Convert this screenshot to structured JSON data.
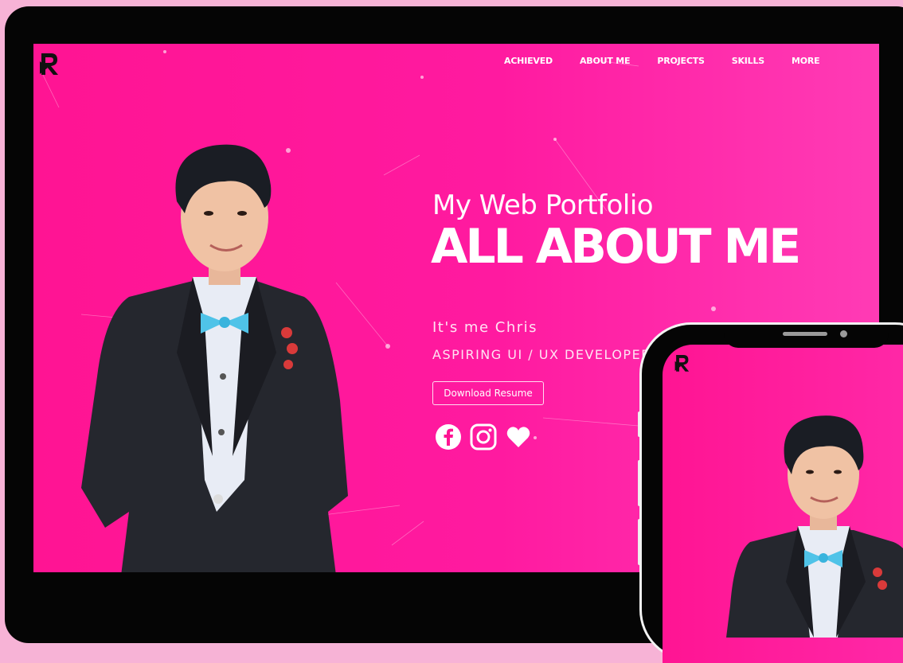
{
  "nav": {
    "items": [
      "ACHIEVED",
      "ABOUT ME",
      "PROJECTS",
      "SKILLS",
      "MORE"
    ]
  },
  "hero": {
    "subtitle": "My Web Portfolio",
    "title": "ALL ABOUT ME",
    "intro": "It's me Chris",
    "role": "ASPIRING UI / UX DEVELOPER",
    "resume_button": "Download Resume"
  },
  "socials": [
    "facebook-icon",
    "instagram-icon",
    "heart-icon"
  ],
  "colors": {
    "accent": "#ff1493",
    "text": "#ffffff",
    "frame": "#050505",
    "background": "#f7b3d6"
  }
}
